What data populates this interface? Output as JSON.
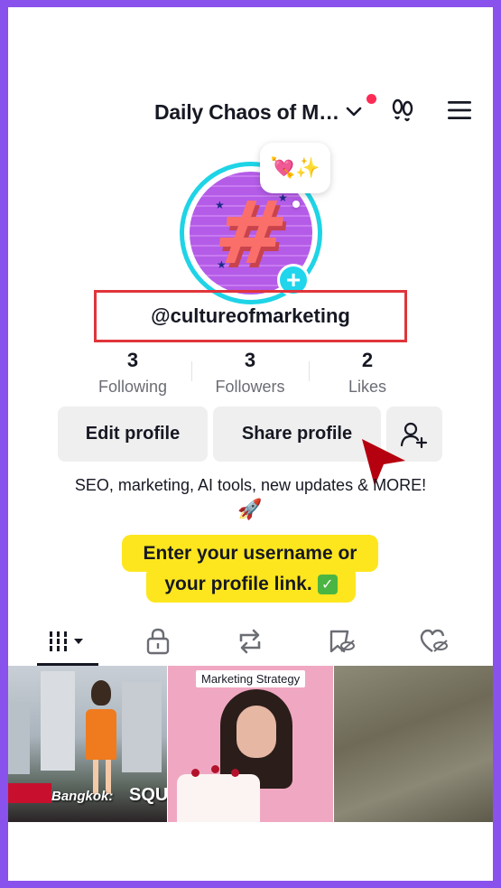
{
  "header": {
    "account_name": "Daily Chaos of M…",
    "icons": [
      "chevron-down-icon",
      "footprints-icon",
      "menu-icon"
    ]
  },
  "profile": {
    "avatar_symbol": "#",
    "mood_emoji": "💘✨",
    "add_badge": "+",
    "username": "@cultureofmarketing"
  },
  "stats": [
    {
      "value": "3",
      "label": "Following"
    },
    {
      "value": "3",
      "label": "Followers"
    },
    {
      "value": "2",
      "label": "Likes"
    }
  ],
  "buttons": {
    "edit": "Edit profile",
    "share": "Share profile"
  },
  "bio": {
    "text": "SEO, marketing, AI tools, new updates & MORE!",
    "emoji": "🚀"
  },
  "callout": {
    "line1": "Enter your username or",
    "line2": "your profile link.",
    "check": "✓"
  },
  "tabs": [
    "videos-grid-tab",
    "private-tab",
    "reposts-tab",
    "favorites-tab",
    "liked-tab"
  ],
  "videos": [
    {
      "caption": "Bangkok:",
      "overlay": "SQUI"
    },
    {
      "caption": "Marketing Strategy"
    },
    {
      "caption": ""
    }
  ],
  "colors": {
    "frame": "#8a52ec",
    "accent_pink": "#fe2c55",
    "ring": "#1ed4e6",
    "highlight": "#fde61e",
    "annotation_red": "#e0353b"
  }
}
